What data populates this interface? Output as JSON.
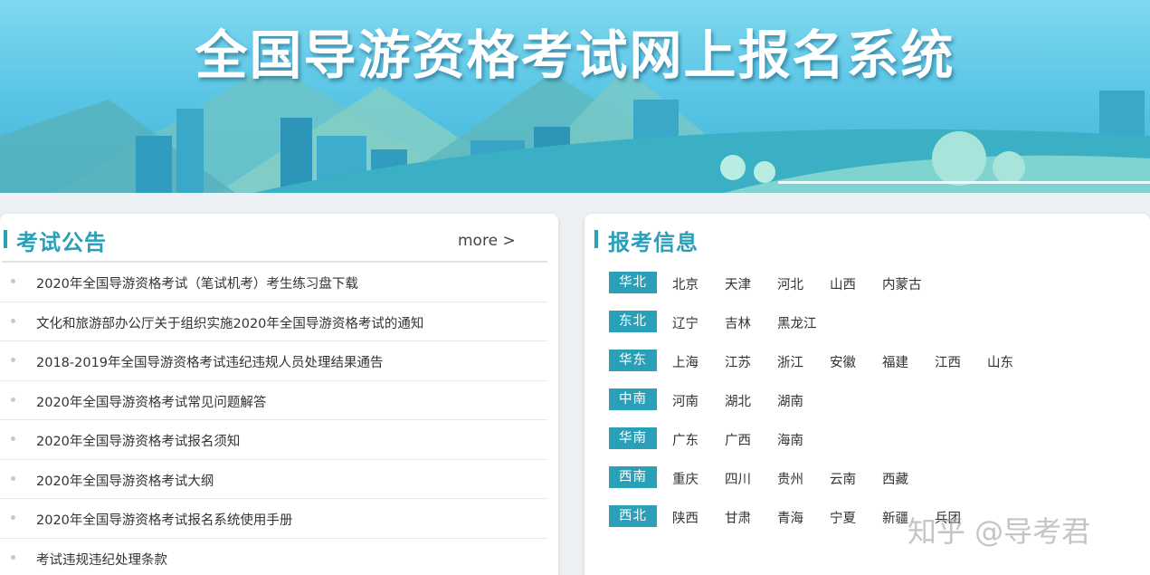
{
  "banner": {
    "title": "全国导游资格考试网上报名系统"
  },
  "notices": {
    "title": "考试公告",
    "more": "more >",
    "items": [
      "2020年全国导游资格考试（笔试机考）考生练习盘下载",
      "文化和旅游部办公厅关于组织实施2020年全国导游资格考试的通知",
      "2018-2019年全国导游资格考试违纪违规人员处理结果通告",
      "2020年全国导游资格考试常见问题解答",
      "2020年全国导游资格考试报名须知",
      "2020年全国导游资格考试大纲",
      "2020年全国导游资格考试报名系统使用手册",
      "考试违规违纪处理条款"
    ]
  },
  "registration": {
    "title": "报考信息",
    "regions": [
      {
        "name": "华北",
        "provinces": [
          "北京",
          "天津",
          "河北",
          "山西",
          "内蒙古"
        ]
      },
      {
        "name": "东北",
        "provinces": [
          "辽宁",
          "吉林",
          "黑龙江"
        ]
      },
      {
        "name": "华东",
        "provinces": [
          "上海",
          "江苏",
          "浙江",
          "安徽",
          "福建",
          "江西",
          "山东"
        ]
      },
      {
        "name": "中南",
        "provinces": [
          "河南",
          "湖北",
          "湖南"
        ]
      },
      {
        "name": "华南",
        "provinces": [
          "广东",
          "广西",
          "海南"
        ]
      },
      {
        "name": "西南",
        "provinces": [
          "重庆",
          "四川",
          "贵州",
          "云南",
          "西藏"
        ]
      },
      {
        "name": "西北",
        "provinces": [
          "陕西",
          "甘肃",
          "青海",
          "宁夏",
          "新疆",
          "兵团"
        ]
      }
    ]
  },
  "watermark": "知乎 @导考君",
  "colors": {
    "accent": "#2aa0b8",
    "banner_sky": "#5cc7e6"
  }
}
